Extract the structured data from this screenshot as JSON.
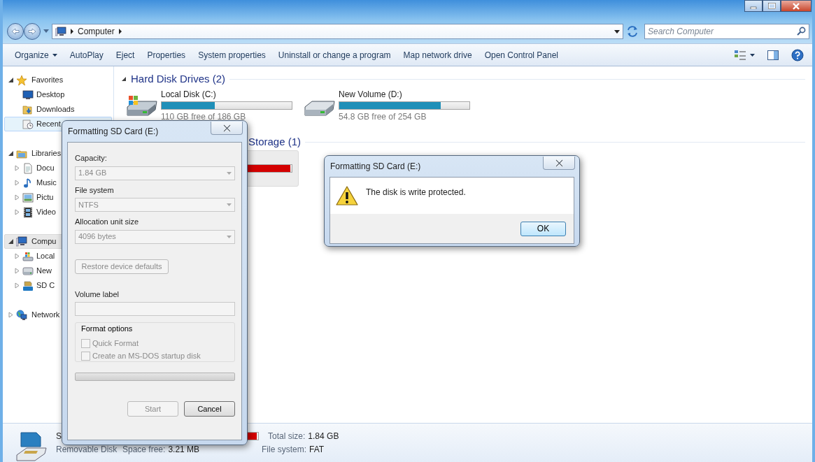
{
  "address_bar": {
    "path": [
      {
        "label": "Computer"
      }
    ],
    "search": {
      "placeholder": "Search Computer"
    }
  },
  "toolbar": [
    {
      "label": "Organize",
      "dropdown": true
    },
    {
      "label": "AutoPlay",
      "dropdown": false
    },
    {
      "label": "Eject",
      "dropdown": false
    },
    {
      "label": "Properties",
      "dropdown": false
    },
    {
      "label": "System properties",
      "dropdown": false
    },
    {
      "label": "Uninstall or change a program",
      "dropdown": false
    },
    {
      "label": "Map network drive",
      "dropdown": false
    },
    {
      "label": "Open Control Panel",
      "dropdown": false
    }
  ],
  "sidebar": [
    {
      "label": "Favorites",
      "expanded": true,
      "selected": false,
      "hovered": false,
      "children": [
        {
          "label": "Desktop",
          "selected": false,
          "hovered": false
        },
        {
          "label": "Downloads",
          "selected": false,
          "hovered": false
        },
        {
          "label": "Recent",
          "selected": false,
          "hovered": true
        }
      ]
    },
    {
      "label": "Libraries",
      "expanded": true,
      "selected": false,
      "hovered": false,
      "children": [
        {
          "label": "Docu",
          "expanded": false,
          "selected": false,
          "hovered": false
        },
        {
          "label": "Music",
          "expanded": false,
          "selected": false,
          "hovered": false
        },
        {
          "label": "Pictu",
          "expanded": false,
          "selected": false,
          "hovered": false
        },
        {
          "label": "Video",
          "expanded": false,
          "selected": false,
          "hovered": false
        }
      ]
    },
    {
      "label": "Compu",
      "expanded": true,
      "selected": true,
      "hovered": false,
      "children": [
        {
          "label": "Local",
          "expanded": false,
          "selected": false,
          "hovered": false
        },
        {
          "label": "New",
          "expanded": false,
          "selected": false,
          "hovered": false
        },
        {
          "label": "SD C",
          "expanded": false,
          "selected": false,
          "hovered": false
        }
      ]
    },
    {
      "label": "Network",
      "expanded": false,
      "selected": false,
      "hovered": false
    }
  ],
  "groups": [
    {
      "title": "Hard Disk Drives (2)",
      "expanded": true,
      "drives": [
        {
          "kind": "system",
          "name": "Local Disk (C:)",
          "level": 0.41,
          "color": "#1f8fb8",
          "free": "110 GB free of 186 GB",
          "selected": false
        },
        {
          "kind": "disk",
          "name": "New Volume (D:)",
          "level": 0.78,
          "color": "#1f8fb8",
          "free": "54.8 GB free of 254 GB",
          "selected": false
        }
      ]
    },
    {
      "title": "Storage (1)",
      "drives": [
        {
          "level": 0.99,
          "color": "#d40000",
          "selected": true
        }
      ]
    }
  ],
  "details": {
    "name": "S",
    "type": "Removable Disk",
    "level": 0.99,
    "color": "#d40000",
    "space_free_label": "Space free:",
    "space_free": "3.21 MB",
    "total_label": "Total size:",
    "total": "1.84 GB",
    "fs_label": "File system:",
    "fs": "FAT"
  },
  "format_dialog": {
    "title": "Formatting SD Card (E:)",
    "selects": [
      {
        "label": "Capacity:",
        "value": "1.84 GB",
        "disabled": true
      },
      {
        "label": "File system",
        "value": "NTFS",
        "disabled": true
      },
      {
        "label": "Allocation unit size",
        "value": "4096 bytes",
        "disabled": true
      }
    ],
    "restore_button": {
      "label": "Restore device defaults",
      "disabled": true
    },
    "volume_label": {
      "label": "Volume label",
      "disabled": true
    },
    "options": {
      "title": "Format options",
      "items": [
        {
          "label": "Quick Format",
          "checked": false,
          "disabled": true
        },
        {
          "label": "Create an MS-DOS startup disk",
          "checked": false,
          "disabled": true
        }
      ]
    },
    "progress": {
      "level": 0
    },
    "buttons": [
      {
        "label": "Start",
        "disabled": true
      },
      {
        "label": "Cancel",
        "disabled": false
      }
    ]
  },
  "message_box": {
    "title": "Formatting SD Card (E:)",
    "message": "The disk is write protected.",
    "buttons": [
      {
        "label": "OK",
        "default": true
      }
    ]
  }
}
